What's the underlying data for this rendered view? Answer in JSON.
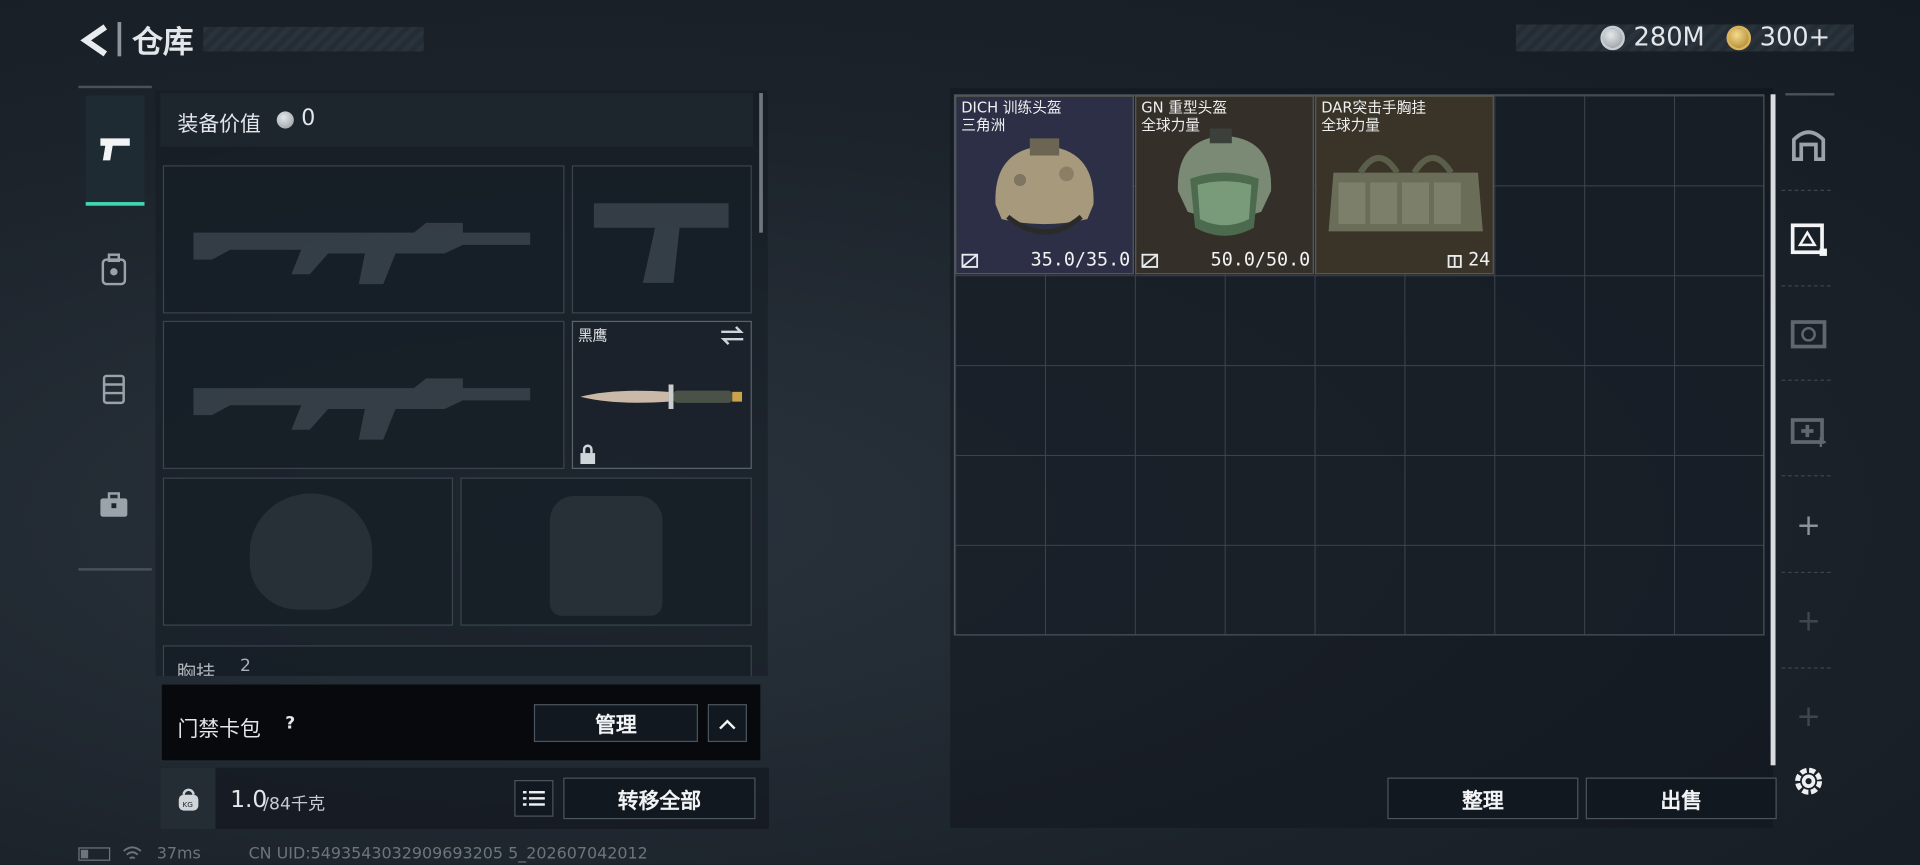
{
  "header": {
    "title": "仓库",
    "currency_silver": "280M",
    "currency_gold": "300+"
  },
  "loadout": {
    "value_label": "装备价值",
    "value": "0",
    "knife_name": "黑鹰",
    "next_section_label": "胸挂",
    "next_section_count": "2"
  },
  "keycard": {
    "label": "门禁卡包",
    "help": "?",
    "manage_label": "管理"
  },
  "weight": {
    "current": "1.0",
    "capacity": "/84千克",
    "transfer_all_label": "转移全部"
  },
  "items": [
    {
      "name": "DICH 训练头盔",
      "source": "三角洲",
      "durability": "35.0/35.0",
      "bg": "#2c2f45"
    },
    {
      "name": "GN 重型头盔",
      "source": "全球力量",
      "durability": "50.0/50.0",
      "bg": "#352f2a"
    },
    {
      "name": "DAR突击手胸挂",
      "source": "全球力量",
      "capacity": "24",
      "bg": "#3a3328"
    }
  ],
  "actions": {
    "organize_label": "整理",
    "sell_label": "出售"
  },
  "status": {
    "ping": "37ms",
    "uid": "CN UID:5493543032909693205 5_202607042012"
  }
}
